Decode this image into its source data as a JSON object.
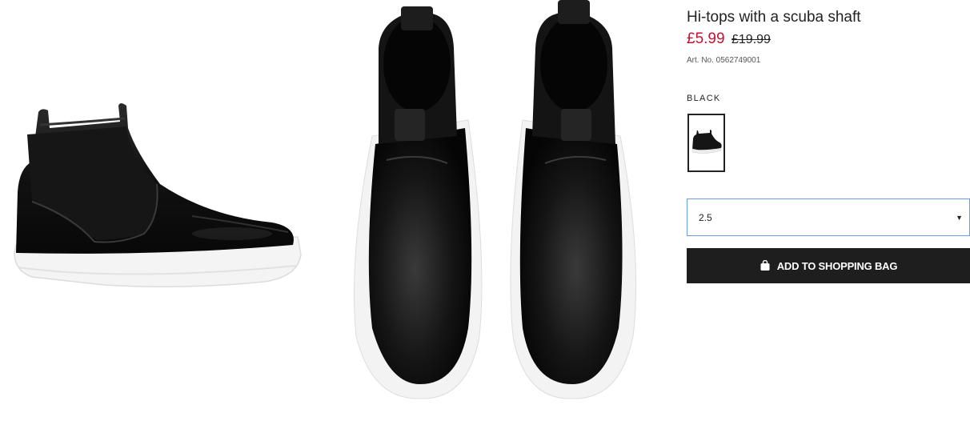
{
  "product": {
    "title": "Hi-tops with a scuba shaft",
    "price_sale": "£5.99",
    "price_original": "£19.99",
    "article_number": "Art. No. 0562749001"
  },
  "color": {
    "label": "BLACK",
    "swatch_icon": "shoe-thumbnail"
  },
  "size_select": {
    "selected": "2.5",
    "caret_icon": "chevron-down-icon"
  },
  "add_to_bag": {
    "label": "ADD TO SHOPPING BAG",
    "icon": "shopping-bag-icon"
  },
  "colors": {
    "sale_red": "#c8102e",
    "button_bg": "#1e1e1e",
    "select_border": "#6e9be6"
  }
}
